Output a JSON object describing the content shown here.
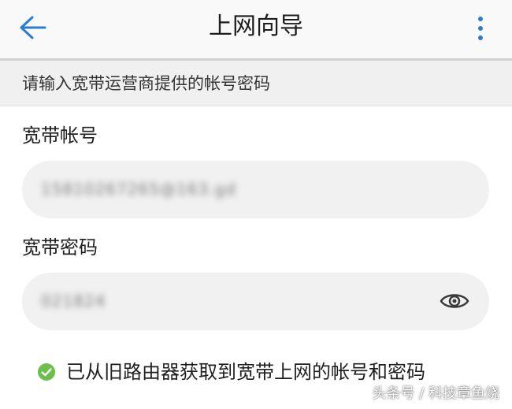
{
  "header": {
    "title": "上网向导"
  },
  "hint": {
    "text": "请输入宽带运营商提供的帐号密码"
  },
  "account": {
    "label": "宽带帐号",
    "value": "15810267265@163.gd"
  },
  "password": {
    "label": "宽带密码",
    "value": "021824"
  },
  "status": {
    "text": "已从旧路由器获取到宽带上网的帐号和密码"
  },
  "watermark": {
    "text": "头条号 / 科技章鱼烧"
  },
  "icons": {
    "back": "arrow-left-icon",
    "more": "more-vertical-icon",
    "eye": "eye-icon",
    "check": "check-circle-icon"
  },
  "colors": {
    "accent": "#2b7cd3",
    "success": "#6cbf4a",
    "input_bg": "#f1f1f1",
    "hint_bg": "#f0f0f0"
  }
}
